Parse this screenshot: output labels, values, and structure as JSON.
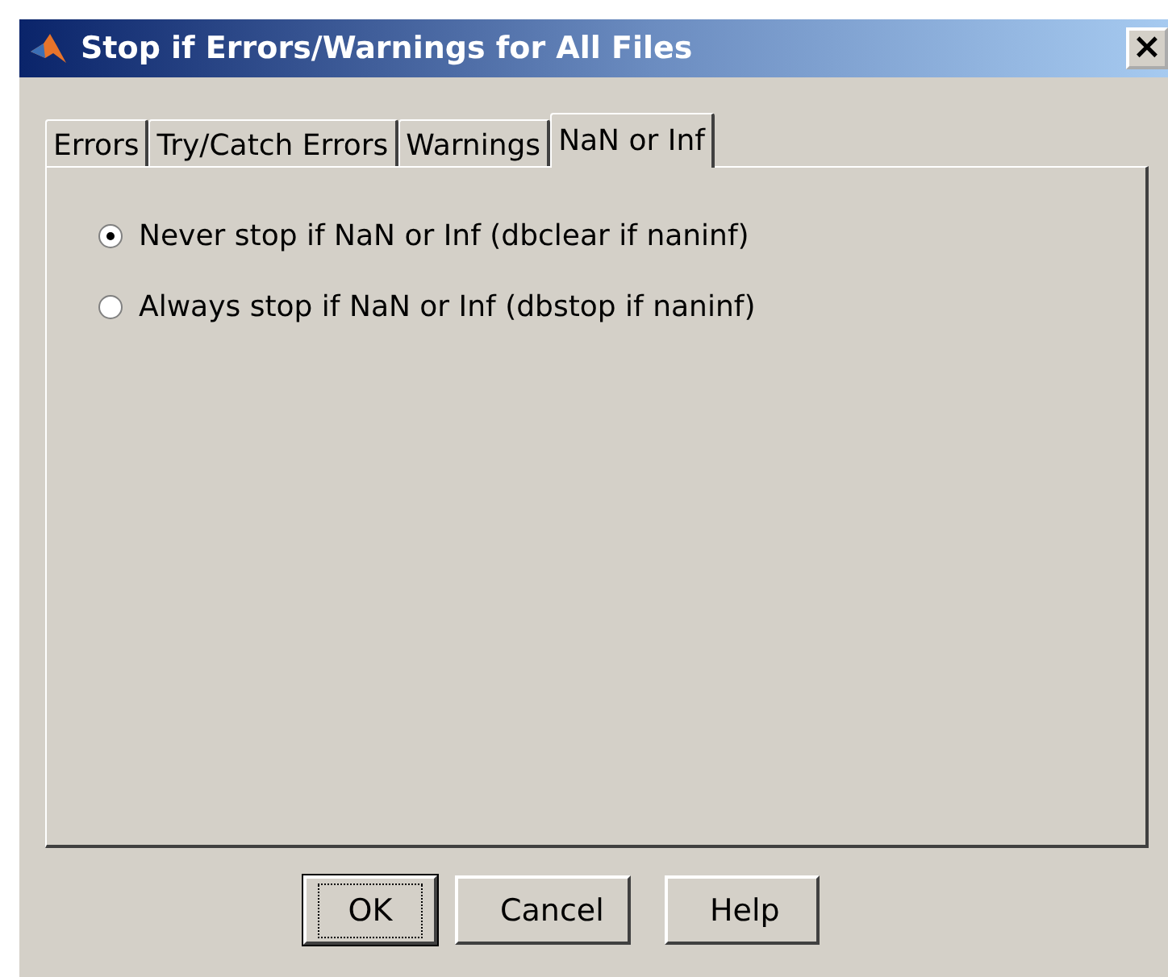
{
  "window": {
    "title": "Stop if Errors/Warnings for All Files",
    "close": "×"
  },
  "tabs": [
    {
      "label": "Errors",
      "selected": false
    },
    {
      "label": "Try/Catch Errors",
      "selected": false
    },
    {
      "label": "Warnings",
      "selected": false
    },
    {
      "label": "NaN or Inf",
      "selected": true
    }
  ],
  "options": [
    {
      "label": "Never stop if NaN or Inf (dbclear if naninf)",
      "selected": true
    },
    {
      "label": "Always stop if NaN or Inf (dbstop if naninf)",
      "selected": false
    }
  ],
  "buttons": [
    {
      "label": "OK",
      "default": true
    },
    {
      "label": "Cancel",
      "default": false
    },
    {
      "label": "Help",
      "default": false
    }
  ]
}
